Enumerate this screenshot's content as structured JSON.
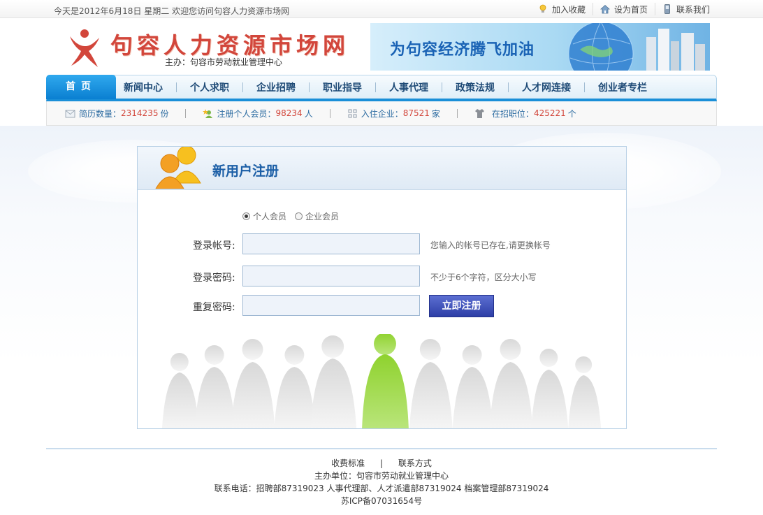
{
  "topbar": {
    "date_text": "今天是2012年6月18日  星期二    欢迎您访问句容人力资源市场网",
    "links": [
      {
        "label": "加入收藏",
        "icon": "lightbulb-icon"
      },
      {
        "label": "设为首页",
        "icon": "home-icon"
      },
      {
        "label": "联系我们",
        "icon": "phone-icon"
      }
    ]
  },
  "header": {
    "site_title": "句容人力资源市场网",
    "sponsor": "主办：句容市劳动就业管理中心",
    "banner_slogan": "为句容经济腾飞加油"
  },
  "nav": {
    "home": "首页",
    "items": [
      "新闻中心",
      "个人求职",
      "企业招聘",
      "职业指导",
      "人事代理",
      "政策法规",
      "人才网连接",
      "创业者专栏"
    ]
  },
  "stats": [
    {
      "label": "简历数量：",
      "value": "2314235",
      "unit": "份",
      "icon": "resume-icon"
    },
    {
      "label": "注册个人会员：",
      "value": "98234",
      "unit": "人",
      "icon": "star-user-icon"
    },
    {
      "label": "入住企业：",
      "value": "87521",
      "unit": "家",
      "icon": "building-icon"
    },
    {
      "label": "在招职位：",
      "value": "425221",
      "unit": "个",
      "icon": "shirt-icon"
    }
  ],
  "register": {
    "title": "新用户注册",
    "member_types": [
      {
        "label": "个人会员",
        "selected": true
      },
      {
        "label": "企业会员",
        "selected": false
      }
    ],
    "fields": [
      {
        "label": "登录帐号:",
        "value": "",
        "hint": "您输入的帐号已存在,请更换帐号"
      },
      {
        "label": "登录密码:",
        "value": "",
        "hint": "不少于6个字符，区分大小写"
      },
      {
        "label": "重复密码:",
        "value": "",
        "hint": ""
      }
    ],
    "submit_label": "立即注册"
  },
  "footer": {
    "links": [
      "收费标准",
      "联系方式"
    ],
    "sponsor": "主办单位：句容市劳动就业管理中心",
    "phones": "联系电话：招聘部87319023  人事代理部、人才派遣部87319024  档案管理部87319024",
    "icp": "苏ICP备07031654号"
  },
  "colors": {
    "nav_home": "#0a7fd1",
    "title_red": "#d2463b",
    "panel_title": "#1b5ea6",
    "stat_number": "#d2463b",
    "submit_button": "#2d3ea6"
  }
}
